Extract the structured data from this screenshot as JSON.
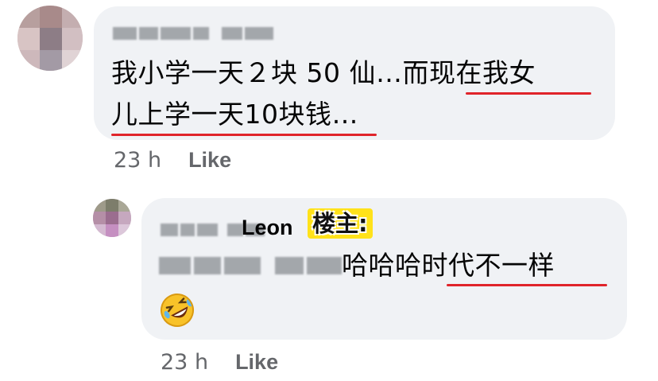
{
  "comment": {
    "author": "Crystal Teoh",
    "line1": "我小学一天２块 50 仙…而现在我女",
    "line2": "儿上学一天10块钱…",
    "time": "23 h",
    "like": "Like"
  },
  "reply": {
    "author_visible": "Leon",
    "op_tag": "楼主:",
    "mention": "Crystal Teoh",
    "text": "哈哈哈时代不一样",
    "emoji": "rolling-on-floor-laughing",
    "time": "23 h",
    "like": "Like"
  },
  "colors": {
    "bubble": "#f0f2f5",
    "underline": "#e0242a",
    "op_tag_bg": "#ffe21a",
    "meta_text": "#65676b"
  }
}
